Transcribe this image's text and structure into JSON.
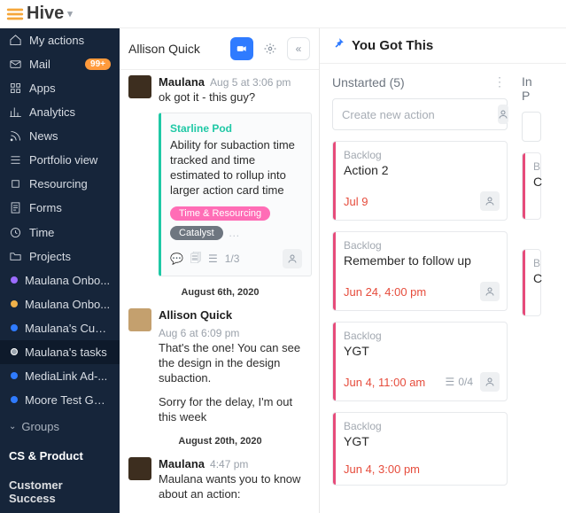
{
  "brand": "Hive",
  "sidebar": {
    "items": [
      {
        "label": "My actions",
        "icon": "home"
      },
      {
        "label": "Mail",
        "icon": "mail",
        "badge": "99+"
      },
      {
        "label": "Apps",
        "icon": "grid"
      },
      {
        "label": "Analytics",
        "icon": "chart"
      },
      {
        "label": "News",
        "icon": "rss"
      },
      {
        "label": "Portfolio view",
        "icon": "list"
      },
      {
        "label": "Resourcing",
        "icon": "chip"
      },
      {
        "label": "Forms",
        "icon": "form"
      },
      {
        "label": "Time",
        "icon": "clock"
      },
      {
        "label": "Projects",
        "icon": "folder"
      }
    ],
    "projects": [
      {
        "label": "Maulana Onbo...",
        "dot": "#9c6cff"
      },
      {
        "label": "Maulana Onbo...",
        "dot": "#f0b24a"
      },
      {
        "label": "Maulana's Cust...",
        "dot": "#2f7bff"
      },
      {
        "label": "Maulana's tasks",
        "dot": "#9aa3ad",
        "active": true
      },
      {
        "label": "MediaLink Ad-...",
        "dot": "#2f7bff"
      },
      {
        "label": "Moore Test Gantt",
        "dot": "#2f7bff"
      }
    ],
    "groupsLabel": "Groups",
    "g1": "CS & Product",
    "g2": "Customer Success"
  },
  "chat": {
    "headerName": "Allison Quick",
    "msgs": [
      {
        "author": "Maulana",
        "time": "Aug 5 at 3:06 pm",
        "text": "ok got it - this guy?",
        "avatar": "dark",
        "card": {
          "project": "Starline Pod",
          "title": "Ability for subaction time tracked and time estimated to rollup into larger action card time",
          "tags": [
            "Time & Resourcing",
            "Catalyst"
          ],
          "sub": "1/3"
        }
      }
    ],
    "divider1": "August 6th, 2020",
    "msg2": {
      "author": "Allison Quick",
      "time": "Aug 6 at 6:09 pm",
      "line1": "That's the one! You can see the design in the design subaction.",
      "line2": "Sorry for the delay, I'm out this week"
    },
    "divider2": "August 20th, 2020",
    "msg3": {
      "author": "Maulana",
      "time": "4:47 pm",
      "text": "Maulana wants you to know about an action:"
    }
  },
  "board": {
    "title": "You Got This",
    "lane1": {
      "name": "Unstarted",
      "count": "(5)",
      "placeholder": "Create new action",
      "cards": [
        {
          "status": "Backlog",
          "title": "Action 2",
          "due": "Jul 9"
        },
        {
          "status": "Backlog",
          "title": "Remember to follow up",
          "due": "Jun 24, 4:00 pm"
        },
        {
          "status": "Backlog",
          "title": "YGT",
          "due": "Jun 4, 11:00 am",
          "sub": "0/4"
        },
        {
          "status": "Backlog",
          "title": "YGT",
          "due": "Jun 4, 3:00 pm"
        }
      ]
    },
    "lane2": {
      "namePartial": "In P",
      "letters": [
        "B",
        "C",
        "B",
        "C"
      ]
    }
  }
}
